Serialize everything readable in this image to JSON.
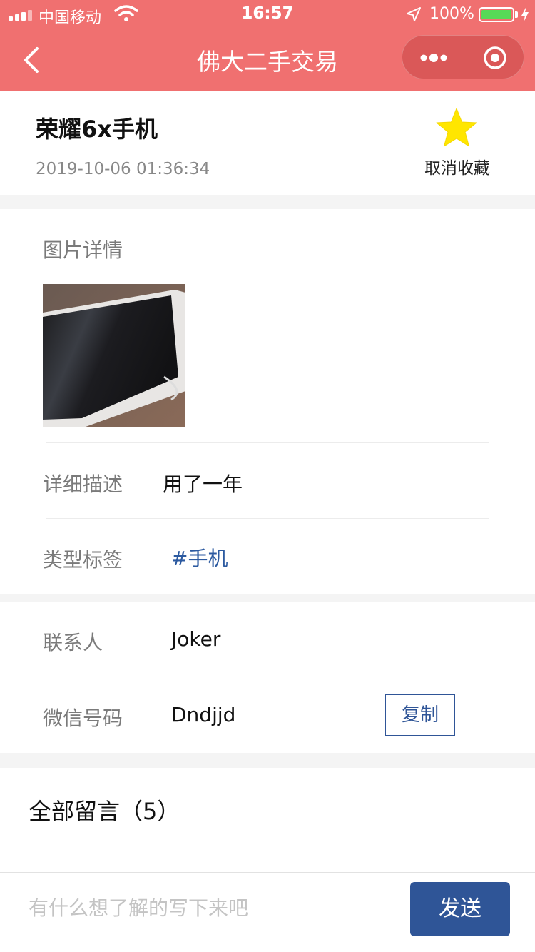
{
  "status_bar": {
    "carrier": "中国移动",
    "time": "16:57",
    "battery": "100%"
  },
  "nav": {
    "title": "佛大二手交易",
    "back_icon": "chevron-left-icon",
    "more_icon": "more-dots-icon",
    "close_icon": "target-circle-icon"
  },
  "item": {
    "title": "荣耀6x手机",
    "date": "2019-10-06 01:36:34",
    "favorite_label": "取消收藏",
    "favorite_icon": "star-icon",
    "star_color": "#ffe600"
  },
  "details": {
    "images_label": "图片详情",
    "description_label": "详细描述",
    "description_value": "用了一年",
    "tag_label": "类型标签",
    "tag_value": "#手机"
  },
  "contact": {
    "name_label": "联系人",
    "name_value": "Joker",
    "wechat_label": "微信号码",
    "wechat_value": "Dndjjd",
    "copy_label": "复制"
  },
  "comments": {
    "title": "全部留言（5）",
    "input_placeholder": "有什么想了解的写下来吧",
    "send_label": "发送"
  },
  "colors": {
    "nav_bg": "#f07070",
    "accent": "#2f5597",
    "tag": "#2c5aa0"
  }
}
